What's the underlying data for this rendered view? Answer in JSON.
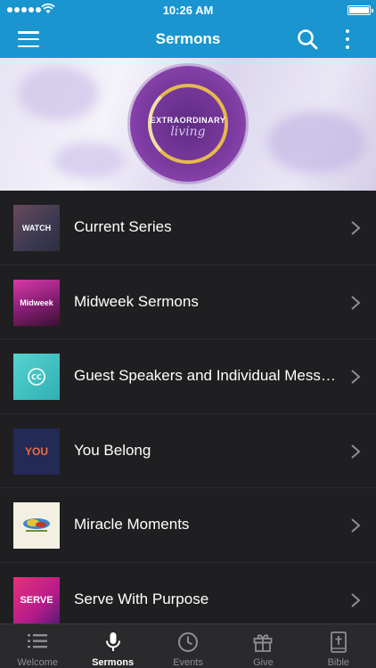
{
  "status_bar": {
    "time": "10:26 AM"
  },
  "nav": {
    "title": "Sermons"
  },
  "hero": {
    "logo_line1": "EXTRAORDINARY",
    "logo_line2": "living"
  },
  "list": {
    "items": [
      {
        "label": "Current Series",
        "thumb_text": "WATCH",
        "icon": "watch-thumbnail"
      },
      {
        "label": "Midweek Sermons",
        "thumb_text": "Midweek",
        "icon": "midweek-thumbnail"
      },
      {
        "label": "Guest Speakers and Individual Messa...",
        "thumb_text": "",
        "icon": "guest-speakers-thumbnail"
      },
      {
        "label": "You Belong",
        "thumb_text": "YOU",
        "icon": "you-belong-thumbnail"
      },
      {
        "label": "Miracle Moments",
        "thumb_text": "",
        "icon": "miracle-moments-thumbnail"
      },
      {
        "label": "Serve With Purpose",
        "thumb_text": "SERVE",
        "icon": "serve-thumbnail"
      }
    ]
  },
  "tabs": [
    {
      "label": "Welcome",
      "icon": "list-icon"
    },
    {
      "label": "Sermons",
      "icon": "microphone-icon",
      "active": true
    },
    {
      "label": "Events",
      "icon": "clock-icon"
    },
    {
      "label": "Give",
      "icon": "gift-icon"
    },
    {
      "label": "Bible",
      "icon": "bible-icon"
    }
  ],
  "colors": {
    "accent": "#1a95cf",
    "background": "#1f1f21",
    "tab_bar": "#2a2a2c",
    "inactive_tab": "#8e8e93"
  }
}
